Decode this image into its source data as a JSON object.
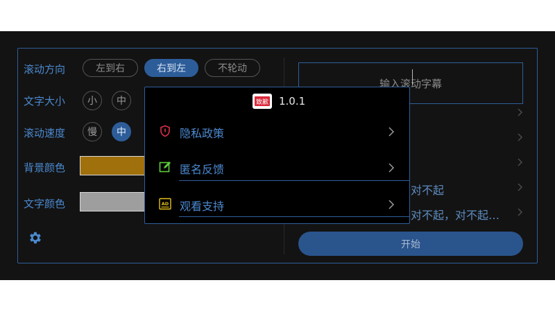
{
  "settings": {
    "direction": {
      "label": "滚动方向",
      "options": [
        {
          "label": "左到右",
          "selected": false
        },
        {
          "label": "右到左",
          "selected": true
        },
        {
          "label": "不轮动",
          "selected": false
        }
      ]
    },
    "font_size": {
      "label": "文字大小",
      "options": [
        {
          "label": "小",
          "selected": false
        },
        {
          "label": "中",
          "selected": false
        }
      ]
    },
    "speed": {
      "label": "滚动速度",
      "options": [
        {
          "label": "慢",
          "selected": false
        },
        {
          "label": "中",
          "selected": true
        }
      ]
    },
    "bg_color": {
      "label": "背景颜色",
      "value": "#a0700c"
    },
    "text_color": {
      "label": "文字颜色",
      "value": "#9e9e9e"
    },
    "settings_icon": "gear-icon"
  },
  "right_panel": {
    "input_placeholder": "输入滚动字幕",
    "history_visible": [
      "对不起",
      "对不起，对不起…"
    ],
    "start_label": "开始"
  },
  "dialog": {
    "logo_text": "致歉",
    "version": "1.0.1",
    "items": [
      {
        "label": "隐私政策",
        "icon": "shield-icon",
        "icon_color": "#e0304a"
      },
      {
        "label": "匿名反馈",
        "icon": "edit-icon",
        "icon_color": "#5fcf3a"
      },
      {
        "label": "观看支持",
        "icon": "ad-icon",
        "icon_color": "#e6c21a"
      }
    ]
  },
  "colors": {
    "accent": "#4b89cf",
    "active_pill": "#2d5d99",
    "border": "#2f5f9c"
  }
}
